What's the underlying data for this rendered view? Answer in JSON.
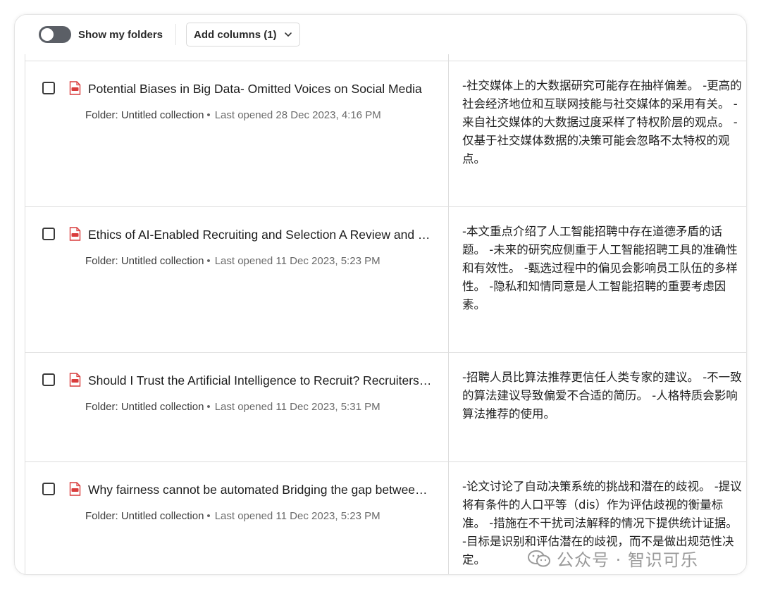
{
  "toolbar": {
    "toggle_label": "Show my folders",
    "toggle_on": false,
    "add_columns_label": "Add columns (1)"
  },
  "rows": [
    {
      "title": "Potential Biases in Big Data- Omitted Voices on Social Media",
      "folder": "Folder: Untitled collection",
      "opened": "Last opened 28 Dec 2023, 4:16 PM",
      "summary": "-社交媒体上的大数据研究可能存在抽样偏差。 -更高的社会经济地位和互联网技能与社交媒体的采用有关。 -来自社交媒体的大数据过度采样了特权阶层的观点。 -仅基于社交媒体数据的决策可能会忽略不太特权的观点。"
    },
    {
      "title": "Ethics of AI-Enabled Recruiting and Selection A Review and Research Agenda",
      "folder": "Folder: Untitled collection",
      "opened": "Last opened 11 Dec 2023, 5:23 PM",
      "summary": "-本文重点介绍了人工智能招聘中存在道德矛盾的话题。 -未来的研究应侧重于人工智能招聘工具的准确性和有效性。 -甄选过程中的偏见会影响员工队伍的多样性。 -隐私和知情同意是人工智能招聘的重要考虑因素。"
    },
    {
      "title": "Should I Trust the Artificial Intelligence to Recruit? Recruiters' Perceptions",
      "folder": "Folder: Untitled collection",
      "opened": "Last opened 11 Dec 2023, 5:31 PM",
      "summary": "-招聘人员比算法推荐更信任人类专家的建议。 -不一致的算法建议导致偏爱不合适的简历。 -人格特质会影响算法推荐的使用。"
    },
    {
      "title": "Why fairness cannot be automated Bridging the gap between EU non-discrimination law and AI",
      "folder": "Folder: Untitled collection",
      "opened": "Last opened 11 Dec 2023, 5:23 PM",
      "summary": "-论文讨论了自动决策系统的挑战和潜在的歧视。 -提议将有条件的人口平等（dis）作为评估歧视的衡量标准。 -措施在不干扰司法解释的情况下提供统计证据。 -目标是识别和评估潜在的歧视，而不是做出规范性决定。"
    }
  ],
  "watermark": {
    "text": "公众号 · 智识可乐"
  },
  "colors": {
    "toggle_off": "#5b5f66",
    "pdf_red": "#d93c3c",
    "border": "#dedede"
  },
  "icons": {
    "row_icon": "pdf-file-icon",
    "dropdown_icon": "chevron-down-icon"
  }
}
